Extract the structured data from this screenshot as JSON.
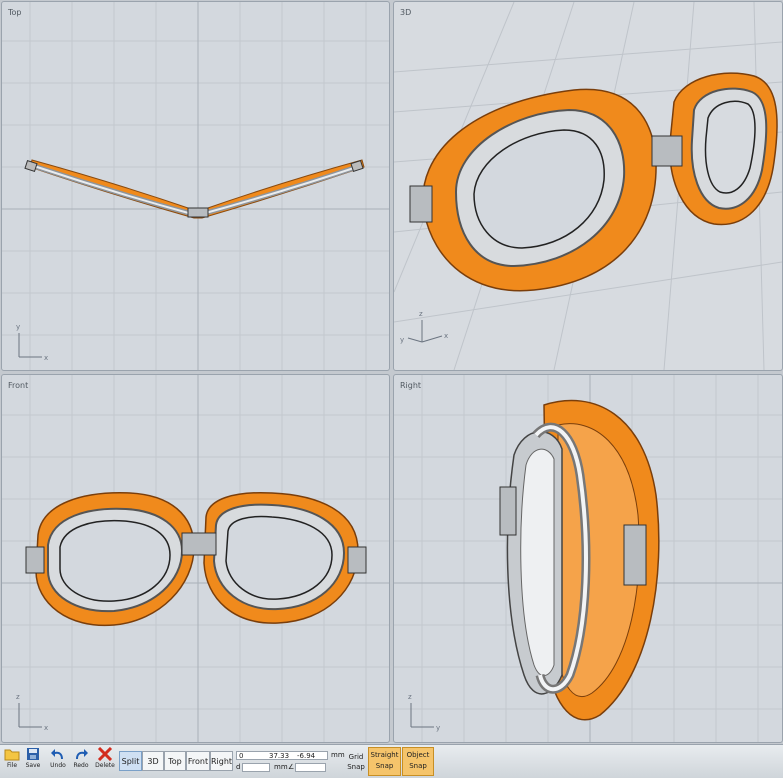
{
  "viewports": {
    "top": {
      "label": "Top"
    },
    "three_d": {
      "label": "3D"
    },
    "front": {
      "label": "Front"
    },
    "right": {
      "label": "Right"
    }
  },
  "axes": {
    "x": "x",
    "y": "y",
    "z": "z"
  },
  "toolbar": {
    "file_label": "File",
    "save_label": "Save",
    "undo_label": "Undo",
    "redo_label": "Redo",
    "delete_label": "Delete",
    "views": [
      "Split",
      "3D",
      "Top",
      "Front",
      "Right"
    ],
    "active_view": "Split",
    "coord_x": "0",
    "coord_y": "37.33",
    "coord_z": "-6.94",
    "unit": "mm",
    "unit2": "mm",
    "distance_value": "",
    "angle_value": "",
    "grid_snap_line1": "Grid",
    "grid_snap_line2": "Snap",
    "straight_snap_line1": "Straight",
    "straight_snap_line2": "Snap",
    "object_snap_line1": "Object",
    "object_snap_line2": "Snap"
  },
  "colors": {
    "accent": "#f08a1c",
    "active_snap": "#f5c46b",
    "viewport_bg": "#d3d8de"
  }
}
